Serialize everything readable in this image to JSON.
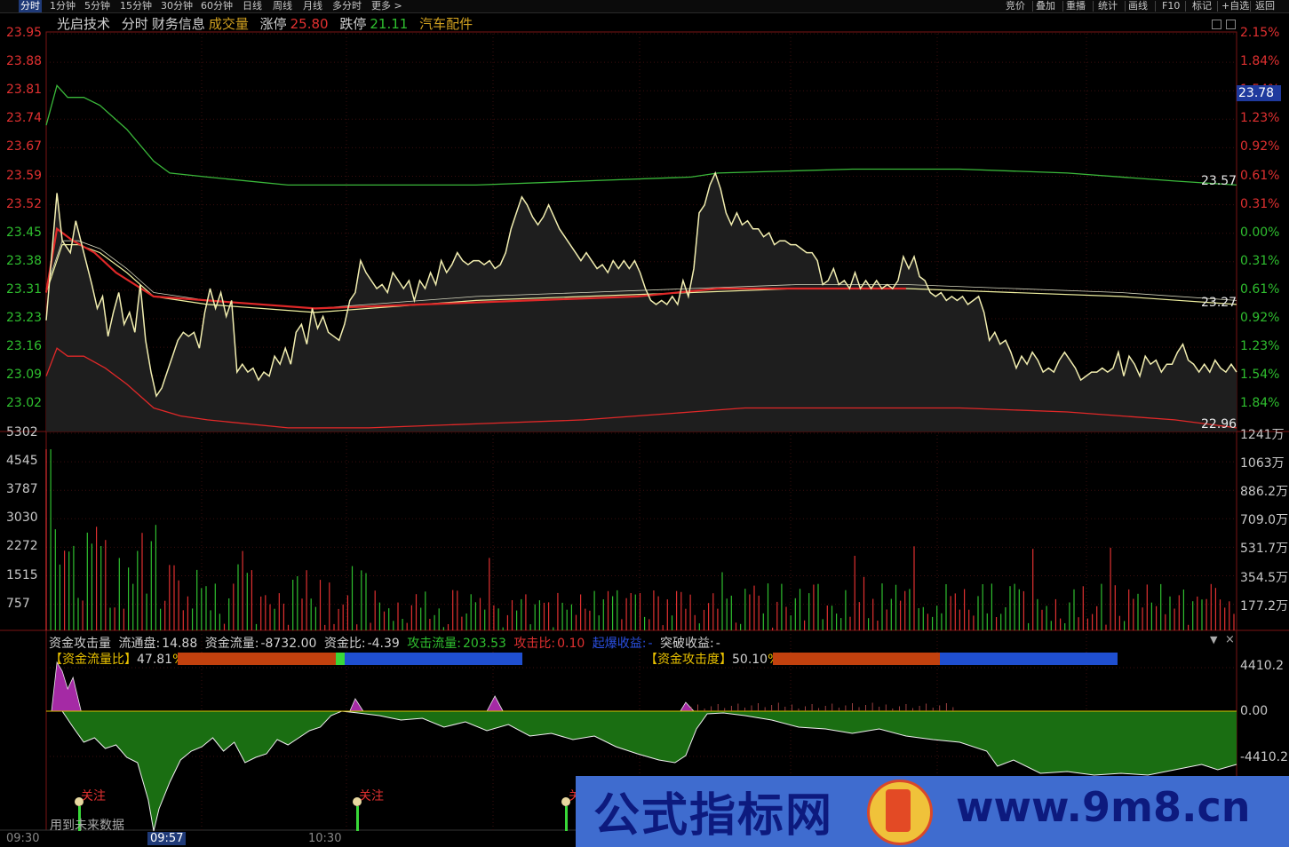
{
  "topbar": {
    "tabs": [
      "分时",
      "1分钟",
      "5分钟",
      "15分钟",
      "30分钟",
      "60分钟",
      "日线",
      "周线",
      "月线",
      "多分时",
      "更多 >"
    ],
    "active": 0,
    "right_items": [
      "竞价",
      "叠加",
      "重播",
      "统计",
      "画线",
      "F10",
      "标记",
      "+自选",
      "返回"
    ]
  },
  "title": {
    "stock": "光启技术",
    "views": [
      "分时",
      "财务信息",
      "成交量"
    ],
    "limit_up_label": "涨停",
    "limit_up": "25.80",
    "limit_down_label": "跌停",
    "limit_down": "21.11",
    "sector": "汽车配件"
  },
  "price_axis": {
    "left": [
      "23.95",
      "23.88",
      "23.81",
      "23.74",
      "23.67",
      "23.59",
      "23.52",
      "23.45",
      "23.38",
      "23.31",
      "23.23",
      "23.16",
      "23.09",
      "23.02"
    ],
    "right": [
      "2.15%",
      "1.84%",
      "1.54%",
      "1.23%",
      "0.92%",
      "0.61%",
      "0.31%",
      "0.00%",
      "0.31%",
      "0.61%",
      "0.92%",
      "1.23%",
      "1.54%",
      "1.84%"
    ],
    "current_price": "23.78",
    "line_labels": {
      "upper": "23.57",
      "middle": "23.27",
      "lower": "22.96"
    }
  },
  "volume_axis": {
    "left": [
      "5302",
      "4545",
      "3787",
      "3030",
      "2272",
      "1515",
      "757"
    ],
    "right": [
      "1241万",
      "1063万",
      "886.2万",
      "709.0万",
      "531.7万",
      "354.5万",
      "177.2万"
    ]
  },
  "indicator": {
    "name": "资金攻击量",
    "float_label": "流通盘:",
    "float_value": "14.88",
    "flow_label": "资金流量:",
    "flow_value": "-8732.00",
    "ratio_label": "资金比:",
    "ratio_value": "-4.39",
    "attack_flow_label": "攻击流量:",
    "attack_flow_value": "203.53",
    "attack_ratio_label": "攻击比:",
    "attack_ratio_value": "0.10",
    "burst_label": "起爆收益:",
    "burst_value": "-",
    "break_label": "突破收益:",
    "break_value": "-",
    "bar1_label": "【资金流量比】",
    "bar1_value": "47.81",
    "bar1_suffix": "%买",
    "bar2_label": "【资金攻击度】",
    "bar2_value": "50.10",
    "bar2_suffix": "%买",
    "axis": [
      "4410.2",
      "0.00",
      "-4410.2"
    ],
    "signal_text": "关注",
    "future_note": "用到未来数据"
  },
  "time_axis": [
    "09:30",
    "09:57",
    "10:30"
  ],
  "watermark": {
    "text": "公式指标网",
    "url": "www.9m8.cn"
  },
  "colors": {
    "price_line": "#f2eeb0",
    "avg_line": "#f0f0a0",
    "red_line": "#e02828",
    "green_line": "#3ab83a",
    "up": "#e03030",
    "down": "#2fbf2f",
    "magenta": "#a52aa5",
    "flow_green": "#1a6e12",
    "bar_orange": "#c2410e",
    "bar_blue": "#1f4fd0"
  },
  "chart_data": {
    "type": "line",
    "price_path": [
      [
        0,
        23.23
      ],
      [
        4,
        23.55
      ],
      [
        6,
        23.43
      ],
      [
        9,
        23.4
      ],
      [
        11,
        23.48
      ],
      [
        14,
        23.4
      ],
      [
        17,
        23.32
      ],
      [
        19,
        23.26
      ],
      [
        21,
        23.29
      ],
      [
        23,
        23.19
      ],
      [
        25,
        23.25
      ],
      [
        27,
        23.3
      ],
      [
        29,
        23.22
      ],
      [
        31,
        23.25
      ],
      [
        33,
        23.2
      ],
      [
        35,
        23.32
      ],
      [
        37,
        23.18
      ],
      [
        39,
        23.1
      ],
      [
        41,
        23.04
      ],
      [
        43,
        23.06
      ],
      [
        45,
        23.1
      ],
      [
        47,
        23.14
      ],
      [
        49,
        23.18
      ],
      [
        51,
        23.2
      ],
      [
        53,
        23.19
      ],
      [
        55,
        23.2
      ],
      [
        57,
        23.16
      ],
      [
        59,
        23.25
      ],
      [
        61,
        23.31
      ],
      [
        63,
        23.26
      ],
      [
        65,
        23.3
      ],
      [
        67,
        23.24
      ],
      [
        69,
        23.28
      ],
      [
        71,
        23.1
      ],
      [
        73,
        23.12
      ],
      [
        75,
        23.1
      ],
      [
        77,
        23.11
      ],
      [
        79,
        23.08
      ],
      [
        81,
        23.1
      ],
      [
        83,
        23.09
      ],
      [
        85,
        23.14
      ],
      [
        87,
        23.12
      ],
      [
        89,
        23.16
      ],
      [
        91,
        23.12
      ],
      [
        93,
        23.2
      ],
      [
        95,
        23.22
      ],
      [
        97,
        23.17
      ],
      [
        99,
        23.26
      ],
      [
        101,
        23.21
      ],
      [
        103,
        23.24
      ],
      [
        105,
        23.2
      ],
      [
        107,
        23.19
      ],
      [
        109,
        23.18
      ],
      [
        111,
        23.22
      ],
      [
        113,
        23.28
      ],
      [
        115,
        23.3
      ],
      [
        117,
        23.38
      ],
      [
        119,
        23.35
      ],
      [
        121,
        23.33
      ],
      [
        123,
        23.31
      ],
      [
        125,
        23.32
      ],
      [
        127,
        23.3
      ],
      [
        129,
        23.35
      ],
      [
        131,
        23.33
      ],
      [
        133,
        23.31
      ],
      [
        135,
        23.33
      ],
      [
        137,
        23.28
      ],
      [
        139,
        23.33
      ],
      [
        141,
        23.31
      ],
      [
        143,
        23.35
      ],
      [
        145,
        23.32
      ],
      [
        147,
        23.38
      ],
      [
        149,
        23.35
      ],
      [
        151,
        23.37
      ],
      [
        153,
        23.4
      ],
      [
        155,
        23.38
      ],
      [
        157,
        23.37
      ],
      [
        159,
        23.38
      ],
      [
        161,
        23.38
      ],
      [
        163,
        23.37
      ],
      [
        165,
        23.38
      ],
      [
        167,
        23.36
      ],
      [
        169,
        23.37
      ],
      [
        171,
        23.4
      ],
      [
        173,
        23.46
      ],
      [
        175,
        23.5
      ],
      [
        177,
        23.54
      ],
      [
        179,
        23.52
      ],
      [
        181,
        23.49
      ],
      [
        183,
        23.47
      ],
      [
        185,
        23.49
      ],
      [
        187,
        23.52
      ],
      [
        189,
        23.49
      ],
      [
        191,
        23.46
      ],
      [
        193,
        23.44
      ],
      [
        195,
        23.42
      ],
      [
        197,
        23.4
      ],
      [
        199,
        23.38
      ],
      [
        201,
        23.4
      ],
      [
        203,
        23.38
      ],
      [
        205,
        23.36
      ],
      [
        207,
        23.37
      ],
      [
        209,
        23.35
      ],
      [
        211,
        23.38
      ],
      [
        213,
        23.36
      ],
      [
        215,
        23.38
      ],
      [
        217,
        23.36
      ],
      [
        219,
        23.38
      ],
      [
        221,
        23.35
      ],
      [
        223,
        23.31
      ],
      [
        225,
        23.28
      ],
      [
        227,
        23.27
      ],
      [
        229,
        23.28
      ],
      [
        231,
        23.27
      ],
      [
        233,
        23.29
      ],
      [
        235,
        23.27
      ],
      [
        237,
        23.33
      ],
      [
        239,
        23.29
      ],
      [
        241,
        23.36
      ],
      [
        243,
        23.5
      ],
      [
        245,
        23.52
      ],
      [
        247,
        23.57
      ],
      [
        249,
        23.6
      ],
      [
        251,
        23.56
      ],
      [
        253,
        23.5
      ],
      [
        255,
        23.47
      ],
      [
        257,
        23.5
      ],
      [
        259,
        23.47
      ],
      [
        261,
        23.48
      ],
      [
        263,
        23.46
      ],
      [
        265,
        23.46
      ],
      [
        267,
        23.44
      ],
      [
        269,
        23.45
      ],
      [
        271,
        23.42
      ],
      [
        273,
        23.43
      ],
      [
        275,
        23.43
      ],
      [
        277,
        23.42
      ],
      [
        279,
        23.42
      ],
      [
        281,
        23.41
      ],
      [
        283,
        23.4
      ],
      [
        285,
        23.4
      ],
      [
        287,
        23.38
      ],
      [
        289,
        23.32
      ],
      [
        291,
        23.33
      ],
      [
        293,
        23.36
      ],
      [
        295,
        23.32
      ],
      [
        297,
        23.33
      ],
      [
        299,
        23.31
      ],
      [
        301,
        23.35
      ],
      [
        303,
        23.31
      ],
      [
        305,
        23.33
      ],
      [
        307,
        23.31
      ],
      [
        309,
        23.33
      ],
      [
        311,
        23.31
      ],
      [
        313,
        23.32
      ],
      [
        315,
        23.31
      ],
      [
        317,
        23.33
      ],
      [
        319,
        23.39
      ],
      [
        321,
        23.36
      ],
      [
        323,
        23.39
      ],
      [
        325,
        23.34
      ],
      [
        327,
        23.33
      ],
      [
        329,
        23.3
      ],
      [
        331,
        23.29
      ],
      [
        333,
        23.3
      ],
      [
        335,
        23.28
      ],
      [
        337,
        23.29
      ],
      [
        339,
        23.28
      ],
      [
        341,
        23.29
      ],
      [
        343,
        23.27
      ],
      [
        345,
        23.28
      ],
      [
        347,
        23.29
      ],
      [
        349,
        23.25
      ],
      [
        351,
        23.18
      ],
      [
        353,
        23.2
      ],
      [
        355,
        23.17
      ],
      [
        357,
        23.18
      ],
      [
        359,
        23.15
      ],
      [
        361,
        23.11
      ],
      [
        363,
        23.14
      ],
      [
        365,
        23.12
      ],
      [
        367,
        23.15
      ],
      [
        369,
        23.13
      ],
      [
        371,
        23.1
      ],
      [
        373,
        23.11
      ],
      [
        375,
        23.1
      ],
      [
        377,
        23.13
      ],
      [
        379,
        23.15
      ],
      [
        381,
        23.13
      ],
      [
        383,
        23.11
      ],
      [
        385,
        23.08
      ],
      [
        387,
        23.09
      ],
      [
        389,
        23.1
      ],
      [
        391,
        23.1
      ],
      [
        393,
        23.11
      ],
      [
        395,
        23.1
      ],
      [
        397,
        23.11
      ],
      [
        399,
        23.15
      ],
      [
        401,
        23.09
      ],
      [
        403,
        23.14
      ],
      [
        405,
        23.12
      ],
      [
        407,
        23.09
      ],
      [
        409,
        23.14
      ],
      [
        411,
        23.12
      ],
      [
        413,
        23.13
      ],
      [
        415,
        23.1
      ],
      [
        417,
        23.12
      ],
      [
        419,
        23.12
      ],
      [
        421,
        23.15
      ],
      [
        423,
        23.17
      ],
      [
        425,
        23.13
      ],
      [
        427,
        23.12
      ],
      [
        429,
        23.1
      ],
      [
        431,
        23.12
      ],
      [
        433,
        23.1
      ],
      [
        435,
        23.13
      ],
      [
        437,
        23.11
      ],
      [
        439,
        23.1
      ],
      [
        441,
        23.12
      ],
      [
        443,
        23.1
      ]
    ],
    "yellow_avg": [
      [
        0,
        23.3
      ],
      [
        6,
        23.42
      ],
      [
        12,
        23.42
      ],
      [
        20,
        23.4
      ],
      [
        30,
        23.35
      ],
      [
        40,
        23.29
      ],
      [
        60,
        23.27
      ],
      [
        80,
        23.26
      ],
      [
        100,
        23.25
      ],
      [
        120,
        23.26
      ],
      [
        160,
        23.28
      ],
      [
        200,
        23.29
      ],
      [
        240,
        23.3
      ],
      [
        280,
        23.31
      ],
      [
        320,
        23.31
      ],
      [
        360,
        23.3
      ],
      [
        400,
        23.29
      ],
      [
        443,
        23.27
      ]
    ],
    "red_line": [
      [
        0,
        23.3
      ],
      [
        4,
        23.46
      ],
      [
        10,
        23.43
      ],
      [
        18,
        23.4
      ],
      [
        26,
        23.35
      ],
      [
        40,
        23.29
      ],
      [
        60,
        23.28
      ],
      [
        100,
        23.26
      ],
      [
        140,
        23.27
      ],
      [
        180,
        23.28
      ],
      [
        220,
        23.29
      ],
      [
        250,
        23.31
      ],
      [
        280,
        23.31
      ],
      [
        300,
        23.31
      ],
      [
        320,
        23.31
      ]
    ],
    "green_upper": [
      [
        0,
        23.72
      ],
      [
        4,
        23.82
      ],
      [
        8,
        23.79
      ],
      [
        14,
        23.79
      ],
      [
        20,
        23.77
      ],
      [
        30,
        23.71
      ],
      [
        40,
        23.63
      ],
      [
        46,
        23.6
      ],
      [
        60,
        23.59
      ],
      [
        90,
        23.57
      ],
      [
        120,
        23.57
      ],
      [
        160,
        23.57
      ],
      [
        200,
        23.58
      ],
      [
        240,
        23.59
      ],
      [
        250,
        23.6
      ],
      [
        300,
        23.61
      ],
      [
        340,
        23.61
      ],
      [
        380,
        23.6
      ],
      [
        420,
        23.58
      ],
      [
        443,
        23.57
      ]
    ],
    "red_lower": [
      [
        0,
        23.09
      ],
      [
        4,
        23.16
      ],
      [
        8,
        23.14
      ],
      [
        14,
        23.14
      ],
      [
        22,
        23.11
      ],
      [
        30,
        23.07
      ],
      [
        40,
        23.01
      ],
      [
        50,
        22.99
      ],
      [
        60,
        22.98
      ],
      [
        90,
        22.96
      ],
      [
        120,
        22.96
      ],
      [
        160,
        22.97
      ],
      [
        200,
        22.98
      ],
      [
        240,
        23.0
      ],
      [
        260,
        23.01
      ],
      [
        300,
        23.01
      ],
      [
        340,
        23.01
      ],
      [
        380,
        23.0
      ],
      [
        420,
        22.98
      ],
      [
        443,
        22.96
      ]
    ],
    "ylim": [
      23.02,
      23.95
    ],
    "volume_peaks": [
      5302,
      3030,
      3100,
      2600,
      2200,
      1900,
      1600,
      1300,
      1100,
      2800,
      2100,
      1800,
      1200,
      900,
      700
    ]
  }
}
